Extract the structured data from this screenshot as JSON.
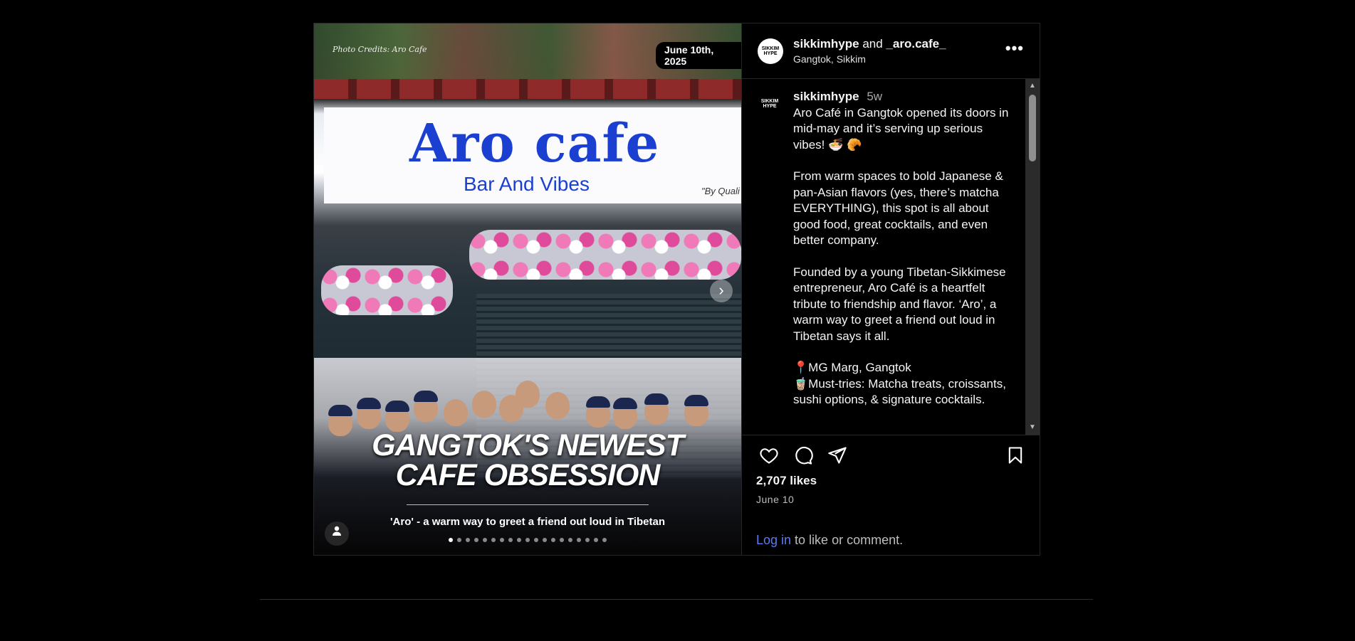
{
  "media": {
    "photo_credit": "Photo Credits: Aro Cafe",
    "date_badge": "June 10th, 2025",
    "sign_title": "Aro cafe",
    "sign_subtitle": "Bar And Vibes",
    "sign_tagline": "\"By Quali",
    "headline_line1": "GANGTOK'S NEWEST",
    "headline_line2": "CAFE OBSESSION",
    "tagline": "'Aro' - a warm way to greet a friend out loud in Tibetan",
    "next_icon": "chevron-right-icon",
    "slide_count": 19,
    "active_slide": 1
  },
  "header": {
    "avatar_text": "SIKKIM HYPE",
    "user": "sikkimhype",
    "and": "and",
    "collab": "_aro.cafe_",
    "location": "Gangtok, Sikkim",
    "more_label": "•••"
  },
  "caption": {
    "avatar_text": "SIKKIM HYPE",
    "user": "sikkimhype",
    "time": "5w",
    "p1": "Aro Café in Gangtok opened its doors in mid-may and it’s serving up serious vibes! 🍜 🥐",
    "p2": "From warm spaces to bold Japanese & pan-Asian flavors (yes, there’s matcha EVERYTHING), this spot is all about good food, great cocktails, and even better company.",
    "p3": "Founded by a young Tibetan-Sikkimese entrepreneur, Aro Café is a heartfelt tribute to friendship and flavor. ‘Aro’, a warm way to greet a friend out loud in Tibetan says it all.",
    "p4a": "📍MG Marg, Gangtok",
    "p4b": "🧋Must-tries: Matcha treats, croissants, sushi options, & signature cocktails."
  },
  "actions": {
    "like_icon": "heart-icon",
    "comment_icon": "comment-icon",
    "share_icon": "send-icon",
    "save_icon": "bookmark-icon"
  },
  "likes": "2,707 likes",
  "post_date": "June 10",
  "login": {
    "link": "Log in",
    "rest": " to like or comment."
  }
}
